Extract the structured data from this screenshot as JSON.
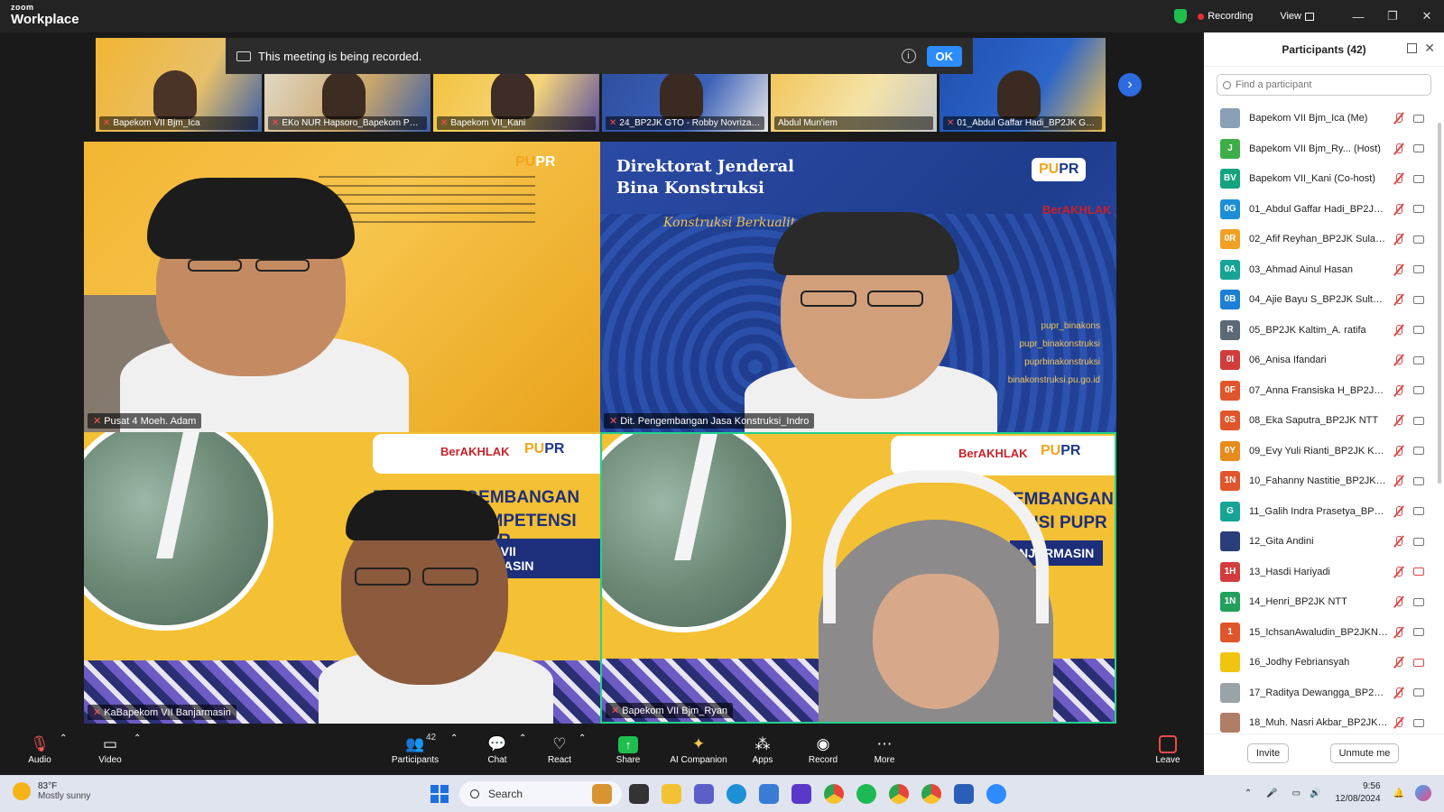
{
  "titlebar": {
    "brand_small": "zoom",
    "brand_large": "Workplace",
    "recording_label": "Recording",
    "view_label": "View"
  },
  "thumbnails": [
    {
      "name": "Bapekom VII Bjm_Ica",
      "bg": "#f2b533"
    },
    {
      "name": "EKo NUR Hapsoro_Bapekom PU...",
      "bg": "#c9a56b"
    },
    {
      "name": "Bapekom VII_Kani",
      "bg": "#f4c034"
    },
    {
      "name": "24_BP2JK GTO - Robby Novrizar...",
      "bg": "#2a4c9c"
    },
    {
      "name": "Abdul Mun'iem",
      "bg": "#f2c14e"
    },
    {
      "name": "01_Abdul Gaffar Hadi_BP2JK Gor...",
      "bg": "#1f4fb0"
    }
  ],
  "recording_banner": {
    "message": "This meeting is being recorded.",
    "ok_label": "OK"
  },
  "tiles": [
    {
      "name": "Pusat 4 Moeh. Adam"
    },
    {
      "name": "Dit. Pengembangan Jasa Konstruksi_Indro",
      "slide_title_1": "Direktorat Jenderal",
      "slide_title_2": "Bina Konstruksi",
      "slide_script": "Konstruksi Berkualitas",
      "social_1": "pupr_binakons",
      "social_2": "pupr_binakonstruksi",
      "social_3": "puprbinakonstruksi",
      "website": "binakonstruksi.pu.go.id"
    },
    {
      "name": "KaBapekom VII Banjarmasin",
      "title_1": "BALAI PENGEMBANGAN",
      "title_2": "KOMPETENSI PUPR",
      "tag": "WILAYAH VII BANJARMASIN"
    },
    {
      "name": "Bapekom VII Bjm_Ryan",
      "title_1": "EMBANGAN",
      "title_2": "NSI PUPR",
      "tag": "NJARMASIN"
    }
  ],
  "logos": {
    "pupr_a": "PU",
    "pupr_b": "PR",
    "berakhlak": "BerAKHLAK"
  },
  "participants": {
    "title": "Participants (42)",
    "search_placeholder": "Find a participant",
    "items": [
      {
        "name": "Bapekom VII Bjm_Ica (Me)",
        "initials": "",
        "color": "#8aa0b6",
        "cam_off": false
      },
      {
        "name": "Bapekom VII Bjm_Ry... (Host)",
        "initials": "J",
        "color": "#3fae49",
        "cam_off": false
      },
      {
        "name": "Bapekom VII_Kani (Co-host)",
        "initials": "BV",
        "color": "#14a37f",
        "cam_off": false
      },
      {
        "name": "01_Abdul Gaffar Hadi_BP2JK G...",
        "initials": "0G",
        "color": "#1d8fd6",
        "cam_off": false
      },
      {
        "name": "02_Afif Reyhan_BP2JK Sulawesi ...",
        "initials": "0R",
        "color": "#f0a023",
        "cam_off": false
      },
      {
        "name": "03_Ahmad Ainul Hasan",
        "initials": "0A",
        "color": "#16a595",
        "cam_off": false
      },
      {
        "name": "04_Ajie Bayu S_BP2JK Sulteng",
        "initials": "0B",
        "color": "#1d7fd6",
        "cam_off": false
      },
      {
        "name": "05_BP2JK Kaltim_A. ratifa",
        "initials": "R",
        "color": "#5c6a78",
        "cam_off": false
      },
      {
        "name": "06_Anisa Ifandari",
        "initials": "0I",
        "color": "#d13d3d",
        "cam_off": false
      },
      {
        "name": "07_Anna Fransiska H_BP2JK Pa...",
        "initials": "0F",
        "color": "#e0562c",
        "cam_off": false
      },
      {
        "name": "08_Eka Saputra_BP2JK NTT",
        "initials": "0S",
        "color": "#e0562c",
        "cam_off": false
      },
      {
        "name": "09_Evy Yuli Rianti_BP2JK Kaltara",
        "initials": "0Y",
        "color": "#e88a1c",
        "cam_off": false
      },
      {
        "name": "10_Fahanny Nastitie_BP2JK DKI",
        "initials": "1N",
        "color": "#e0562c",
        "cam_off": false
      },
      {
        "name": "11_Galih Indra Prasetya_BP2JK ...",
        "initials": "G",
        "color": "#16a595",
        "cam_off": false
      },
      {
        "name": "12_Gita Andini",
        "initials": "",
        "color": "#2a3f7a",
        "cam_off": false
      },
      {
        "name": "13_Hasdi Hariyadi",
        "initials": "1H",
        "color": "#d13d3d",
        "cam_off": true
      },
      {
        "name": "14_Henri_BP2JK NTT",
        "initials": "1N",
        "color": "#23a05c",
        "cam_off": false
      },
      {
        "name": "15_IchsanAwaludin_BP2JKNTT",
        "initials": "1",
        "color": "#e0562c",
        "cam_off": false
      },
      {
        "name": "16_Jodhy Febriansyah",
        "initials": "",
        "color": "#f1c40f",
        "cam_off": true
      },
      {
        "name": "17_Raditya Dewangga_BP2JK S...",
        "initials": "",
        "color": "#9aa3a8",
        "cam_off": false
      },
      {
        "name": "18_Muh. Nasri Akbar_BP2JK Kal...",
        "initials": "",
        "color": "#b07d66",
        "cam_off": false
      }
    ],
    "invite_label": "Invite",
    "unmute_label": "Unmute me"
  },
  "toolbar": {
    "audio": "Audio",
    "video": "Video",
    "participants": "Participants",
    "participants_count": "42",
    "chat": "Chat",
    "react": "React",
    "share": "Share",
    "ai_companion": "AI Companion",
    "apps": "Apps",
    "record": "Record",
    "more": "More",
    "leave": "Leave"
  },
  "taskbar": {
    "temp": "83°F",
    "condition": "Mostly sunny",
    "search_label": "Search",
    "time": "9:56",
    "date": "12/08/2024"
  }
}
